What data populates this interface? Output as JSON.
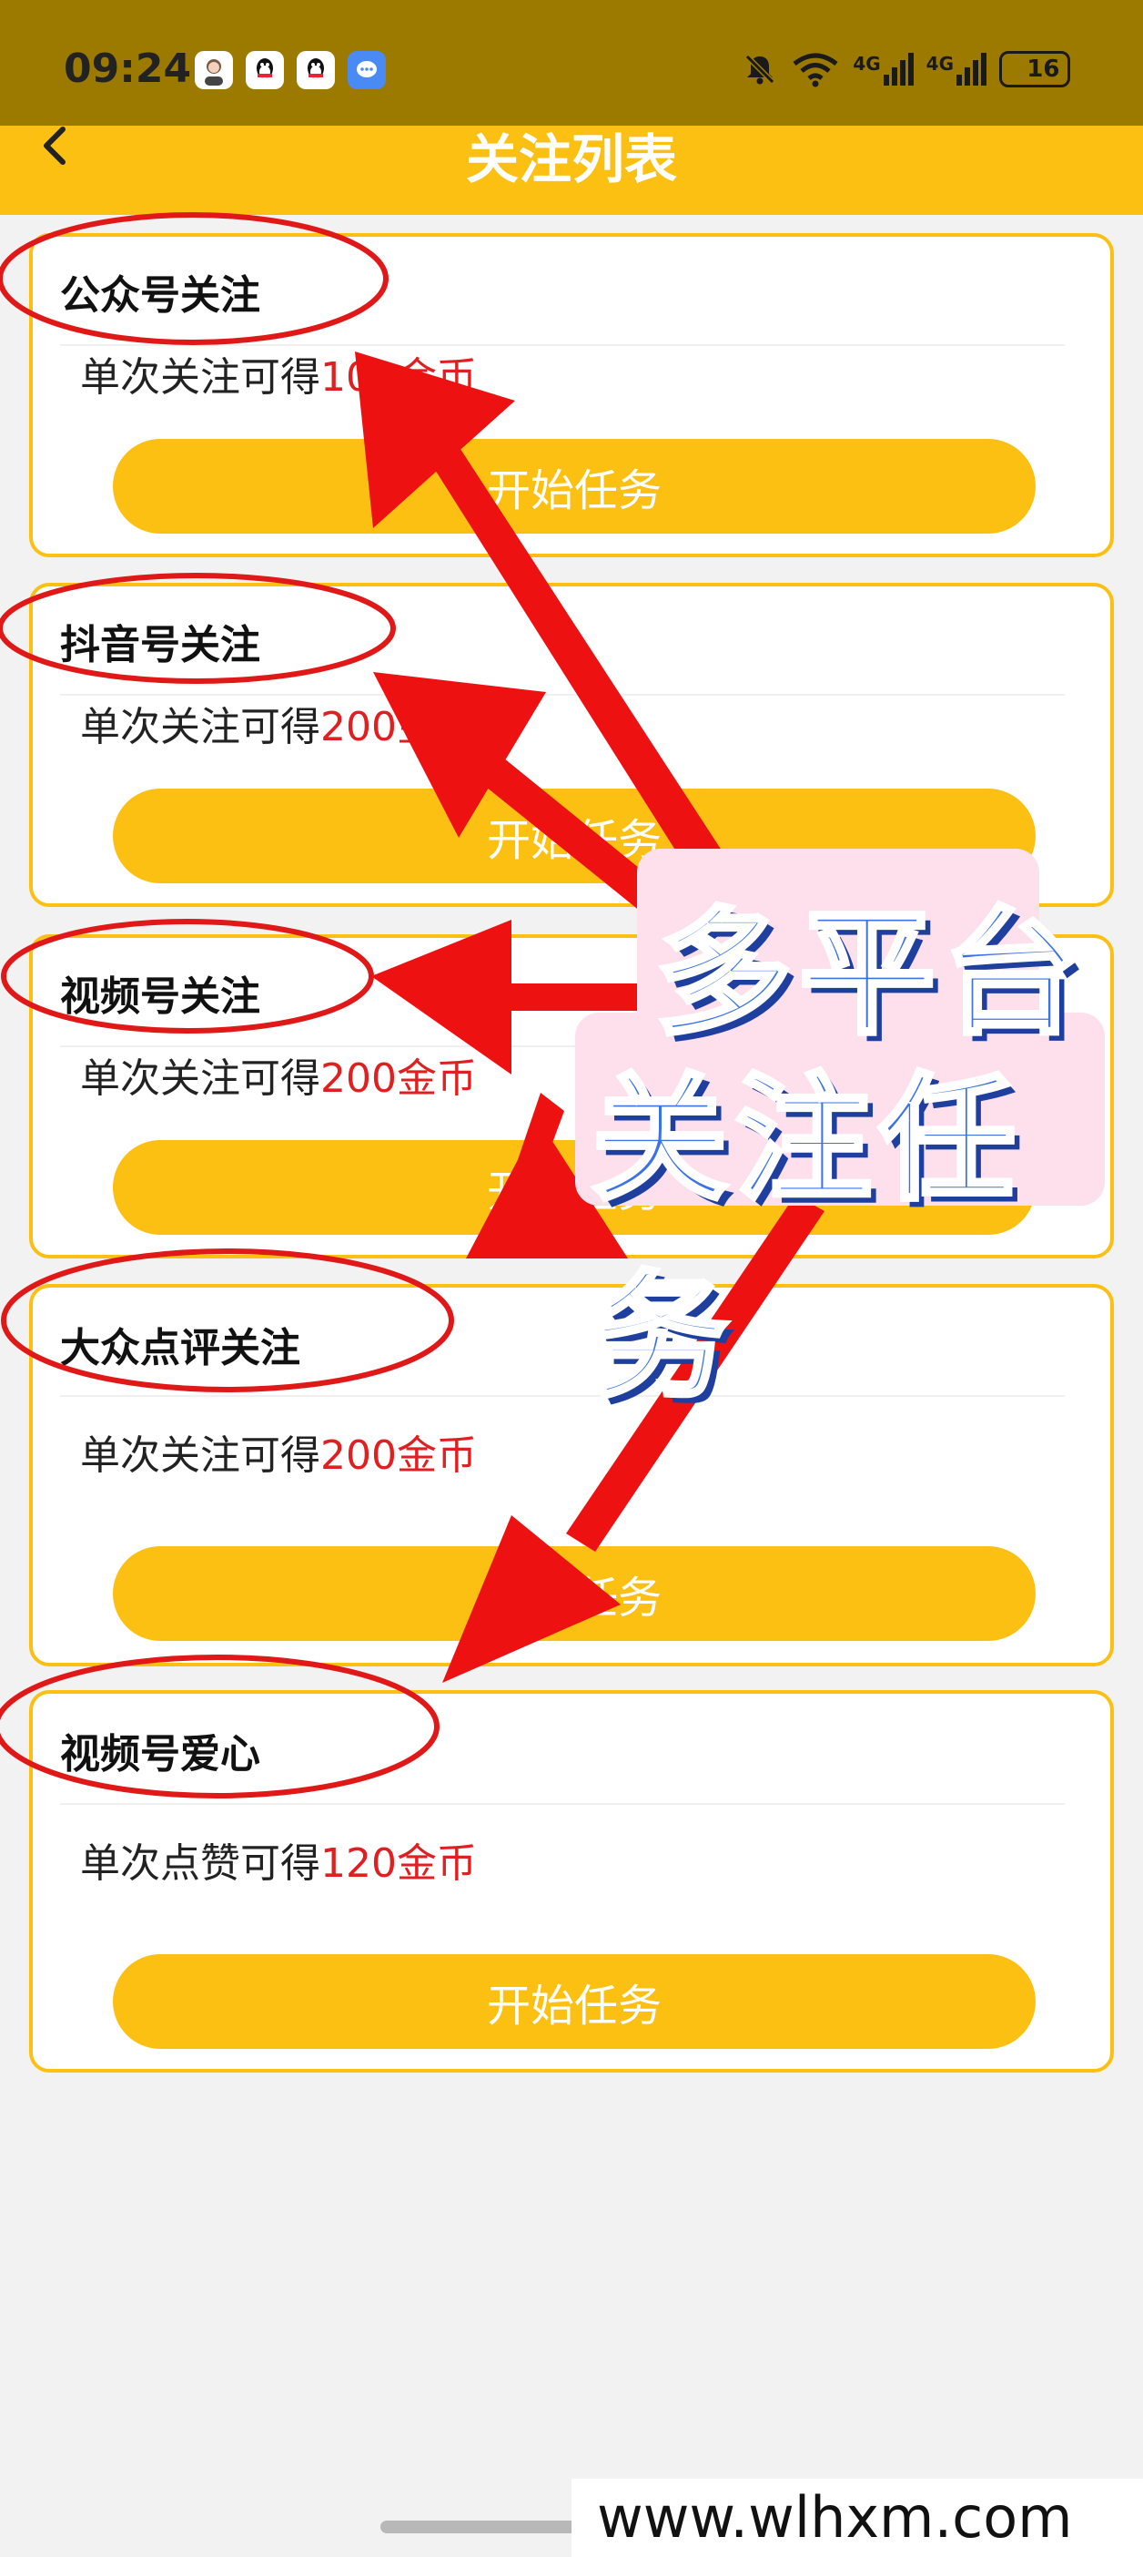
{
  "status_bar": {
    "time": "09:24",
    "app_icons": [
      "avatar-icon",
      "qq-icon",
      "qq-icon",
      "message-icon"
    ],
    "signal_labels": [
      "4G",
      "4G"
    ],
    "battery": "16"
  },
  "header": {
    "title": "关注列表",
    "back_icon": "chevron-left-icon"
  },
  "tasks": [
    {
      "title": "公众号关注",
      "reward_prefix": "单次关注可得",
      "reward_amount": "100金币",
      "button": "开始任务"
    },
    {
      "title": "抖音号关注",
      "reward_prefix": "单次关注可得",
      "reward_amount": "200金币",
      "button": "开始任务"
    },
    {
      "title": "视频号关注",
      "reward_prefix": "单次关注可得",
      "reward_amount": "200金币",
      "button": "开始任务"
    },
    {
      "title": "大众点评关注",
      "reward_prefix": "单次关注可得",
      "reward_amount": "200金币",
      "button": "开始任务"
    },
    {
      "title": "视频号爱心",
      "reward_prefix": "单次点赞可得",
      "reward_amount": "120金币",
      "button": "开始任务"
    }
  ],
  "promo": {
    "line1": "多平台",
    "line2": "关注任务"
  },
  "watermark": "www.wlhxm.com",
  "colors": {
    "accent": "#fcc012",
    "reward": "#e02020",
    "annotation": "#ee1111",
    "promo_text": "#3b73e6"
  }
}
